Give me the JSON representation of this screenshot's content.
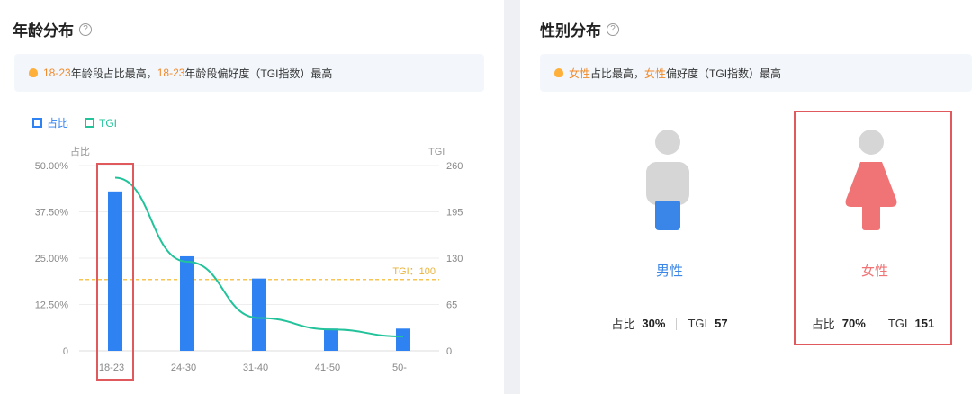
{
  "age": {
    "title": "年龄分布",
    "help": "?",
    "insight": {
      "hl1": "18-23",
      "t1": "年龄段占比最高，",
      "hl2": "18-23",
      "t2": "年龄段偏好度（TGI指数）最高"
    },
    "legend": [
      {
        "label": "占比",
        "color": "#2f82f2"
      },
      {
        "label": "TGI",
        "color": "#22c39a"
      }
    ]
  },
  "gender": {
    "title": "性别分布",
    "help": "?",
    "insight": {
      "hl1": "女性",
      "t1": "占比最高，",
      "hl2": "女性",
      "t2": "偏好度（TGI指数）最高"
    },
    "male": {
      "label": "男性",
      "share_label": "占比",
      "share": "30%",
      "tgi_label": "TGI",
      "tgi": "57",
      "color": "#3a86e8"
    },
    "female": {
      "label": "女性",
      "share_label": "占比",
      "share": "70%",
      "tgi_label": "TGI",
      "tgi": "151",
      "color": "#f07475"
    }
  },
  "chart_data": {
    "type": "bar",
    "categories": [
      "18-23",
      "24-30",
      "31-40",
      "41-50",
      "50-"
    ],
    "series": [
      {
        "name": "占比",
        "type": "bar",
        "axis": "left",
        "values": [
          43.0,
          25.5,
          19.5,
          6.0,
          6.0
        ],
        "color": "#2f82f2"
      },
      {
        "name": "TGI",
        "type": "line",
        "axis": "right",
        "values": [
          243,
          125,
          46,
          30,
          20
        ],
        "color": "#22c39a"
      }
    ],
    "yleft": {
      "label": "占比",
      "ticks": [
        "0",
        "12.50%",
        "25.00%",
        "37.50%",
        "50.00%"
      ],
      "ylim": [
        0,
        50
      ]
    },
    "yright": {
      "label": "TGI",
      "ticks": [
        "0",
        "65",
        "130",
        "195",
        "260"
      ],
      "ylim": [
        0,
        260
      ]
    },
    "reference_line": {
      "label": "TGI：100",
      "value": 100,
      "axis": "right",
      "color": "#f7c453"
    },
    "grid": true
  }
}
